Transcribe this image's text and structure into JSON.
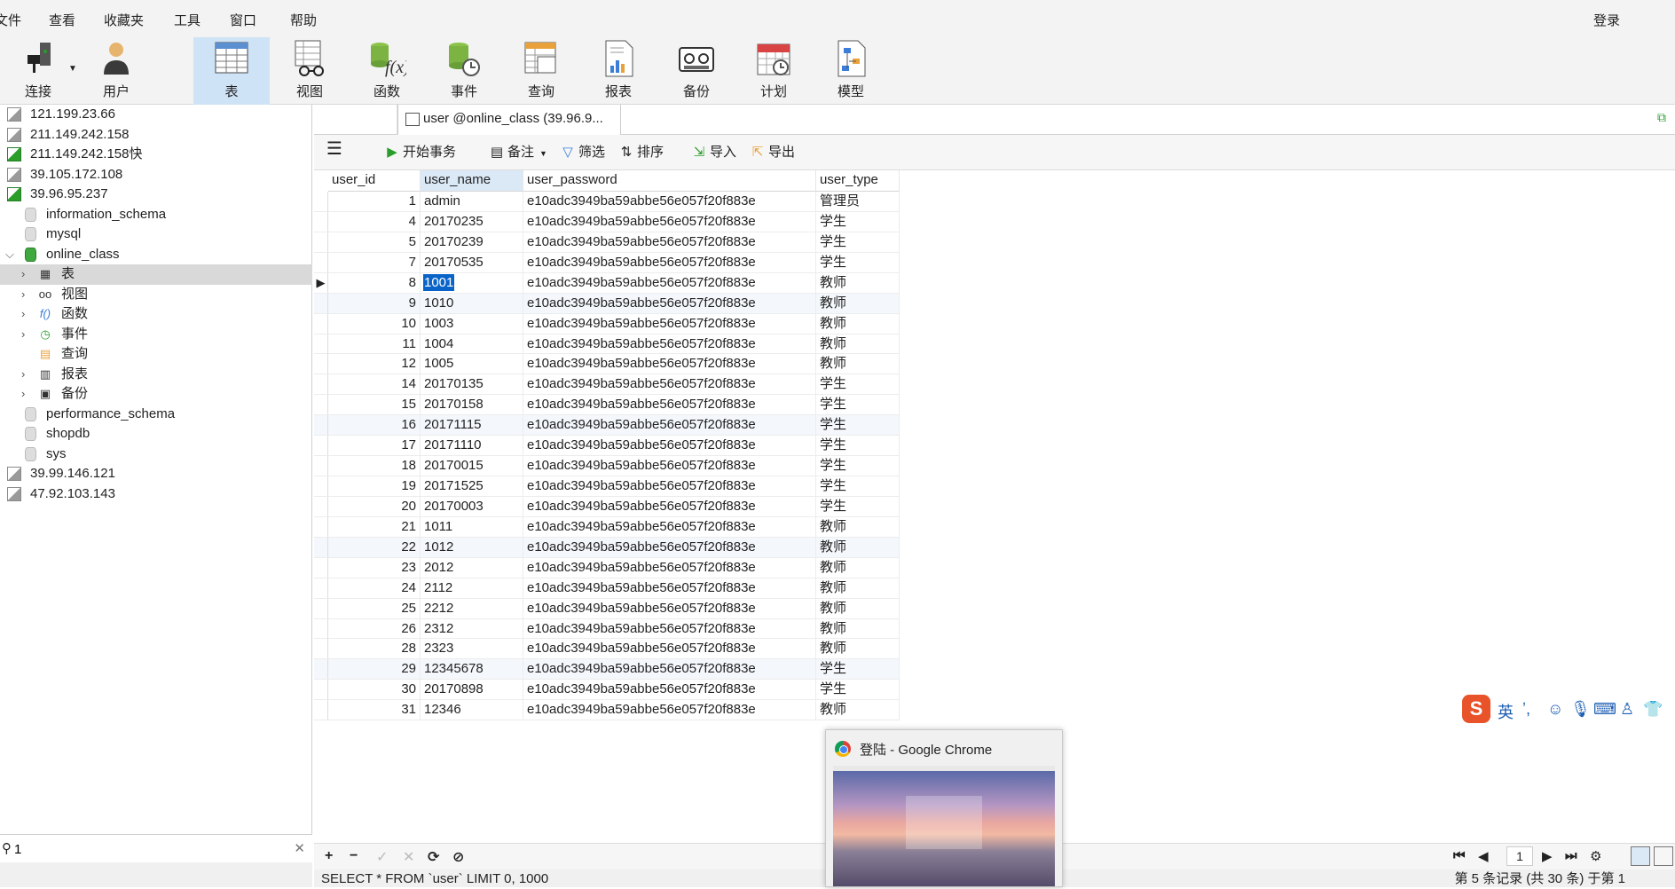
{
  "menu": {
    "items": [
      "文件",
      "查看",
      "收藏夹",
      "工具",
      "窗口",
      "帮助"
    ],
    "login": "登录"
  },
  "toolbar": {
    "buttons": [
      {
        "label": "连接",
        "icon": "connect-icon"
      },
      {
        "label": "用户",
        "icon": "user-icon"
      },
      {
        "label": "表",
        "icon": "table-icon",
        "active": true
      },
      {
        "label": "视图",
        "icon": "view-icon"
      },
      {
        "label": "函数",
        "icon": "function-icon"
      },
      {
        "label": "事件",
        "icon": "event-icon"
      },
      {
        "label": "查询",
        "icon": "query-icon"
      },
      {
        "label": "报表",
        "icon": "report-icon"
      },
      {
        "label": "备份",
        "icon": "backup-icon"
      },
      {
        "label": "计划",
        "icon": "schedule-icon"
      },
      {
        "label": "模型",
        "icon": "model-icon"
      }
    ]
  },
  "sidebar": {
    "items": [
      {
        "text": "121.199.23.66",
        "kind": "conn",
        "on": false
      },
      {
        "text": "211.149.242.158",
        "kind": "conn",
        "on": false
      },
      {
        "text": "211.149.242.158快",
        "kind": "conn",
        "on": true
      },
      {
        "text": "39.105.172.108",
        "kind": "conn",
        "on": false
      },
      {
        "text": "39.96.95.237",
        "kind": "conn",
        "on": true
      },
      {
        "text": "information_schema",
        "kind": "db",
        "on": false
      },
      {
        "text": "mysql",
        "kind": "db",
        "on": false
      },
      {
        "text": "online_class",
        "kind": "db",
        "on": true
      },
      {
        "text": "表",
        "kind": "obj",
        "icon": "table-icon"
      },
      {
        "text": "视图",
        "kind": "obj",
        "icon": "view-icon"
      },
      {
        "text": "函数",
        "kind": "obj",
        "icon": "function-icon"
      },
      {
        "text": "事件",
        "kind": "obj",
        "icon": "event-icon"
      },
      {
        "text": "查询",
        "kind": "obj",
        "icon": "query-icon"
      },
      {
        "text": "报表",
        "kind": "obj",
        "icon": "report-icon"
      },
      {
        "text": "备份",
        "kind": "obj",
        "icon": "backup-icon"
      },
      {
        "text": "performance_schema",
        "kind": "db",
        "on": false
      },
      {
        "text": "shopdb",
        "kind": "db",
        "on": false
      },
      {
        "text": "sys",
        "kind": "db",
        "on": false
      },
      {
        "text": "39.99.146.121",
        "kind": "conn",
        "on": false
      },
      {
        "text": "47.92.103.143",
        "kind": "conn",
        "on": false
      }
    ],
    "search_value": "1",
    "search_icon": "search-icon",
    "clear_icon": "close-icon"
  },
  "tab": {
    "title": "user @online_class (39.96.9..."
  },
  "actions": {
    "menu_icon": "hamburger-menu-icon",
    "begin_transaction": "开始事务",
    "comment": "备注",
    "filter": "筛选",
    "sort": "排序",
    "import": "导入",
    "export": "导出"
  },
  "grid": {
    "columns": [
      "user_id",
      "user_name",
      "user_password",
      "user_type"
    ],
    "rows": [
      [
        "1",
        "admin",
        "e10adc3949ba59abbe56e057f20f883e",
        "管理员"
      ],
      [
        "4",
        "20170235",
        "e10adc3949ba59abbe56e057f20f883e",
        "学生"
      ],
      [
        "5",
        "20170239",
        "e10adc3949ba59abbe56e057f20f883e",
        "学生"
      ],
      [
        "7",
        "20170535",
        "e10adc3949ba59abbe56e057f20f883e",
        "学生"
      ],
      [
        "8",
        "1001",
        "e10adc3949ba59abbe56e057f20f883e",
        "教师"
      ],
      [
        "9",
        "1010",
        "e10adc3949ba59abbe56e057f20f883e",
        "教师"
      ],
      [
        "10",
        "1003",
        "e10adc3949ba59abbe56e057f20f883e",
        "教师"
      ],
      [
        "11",
        "1004",
        "e10adc3949ba59abbe56e057f20f883e",
        "教师"
      ],
      [
        "12",
        "1005",
        "e10adc3949ba59abbe56e057f20f883e",
        "教师"
      ],
      [
        "14",
        "20170135",
        "e10adc3949ba59abbe56e057f20f883e",
        "学生"
      ],
      [
        "15",
        "20170158",
        "e10adc3949ba59abbe56e057f20f883e",
        "学生"
      ],
      [
        "16",
        "20171115",
        "e10adc3949ba59abbe56e057f20f883e",
        "学生"
      ],
      [
        "17",
        "20171110",
        "e10adc3949ba59abbe56e057f20f883e",
        "学生"
      ],
      [
        "18",
        "20170015",
        "e10adc3949ba59abbe56e057f20f883e",
        "学生"
      ],
      [
        "19",
        "20171525",
        "e10adc3949ba59abbe56e057f20f883e",
        "学生"
      ],
      [
        "20",
        "20170003",
        "e10adc3949ba59abbe56e057f20f883e",
        "学生"
      ],
      [
        "21",
        "1011",
        "e10adc3949ba59abbe56e057f20f883e",
        "教师"
      ],
      [
        "22",
        "1012",
        "e10adc3949ba59abbe56e057f20f883e",
        "教师"
      ],
      [
        "23",
        "2012",
        "e10adc3949ba59abbe56e057f20f883e",
        "教师"
      ],
      [
        "24",
        "2112",
        "e10adc3949ba59abbe56e057f20f883e",
        "教师"
      ],
      [
        "25",
        "2212",
        "e10adc3949ba59abbe56e057f20f883e",
        "教师"
      ],
      [
        "26",
        "2312",
        "e10adc3949ba59abbe56e057f20f883e",
        "教师"
      ],
      [
        "28",
        "2323",
        "e10adc3949ba59abbe56e057f20f883e",
        "教师"
      ],
      [
        "29",
        "12345678",
        "e10adc3949ba59abbe56e057f20f883e",
        "学生"
      ],
      [
        "30",
        "20170898",
        "e10adc3949ba59abbe56e057f20f883e",
        "学生"
      ],
      [
        "31",
        "12346",
        "e10adc3949ba59abbe56e057f20f883e",
        "教师"
      ]
    ],
    "selected_row_index": 4,
    "current_marker_icon": "row-pointer-icon"
  },
  "grid_controls": {
    "add": "+",
    "delete": "−",
    "apply": "✓",
    "cancel": "✕",
    "refresh": "⟳",
    "stop": "⊘"
  },
  "status": {
    "sql": "SELECT * FROM `user` LIMIT 0, 1000",
    "record_info": "第 5 条记录 (共 30 条) 于第 1",
    "page": "1"
  },
  "chrome_preview": {
    "title": "登陆 - Google Chrome",
    "icon": "chrome-icon"
  },
  "ime": {
    "brand": "S",
    "lang": "英"
  },
  "colors": {
    "accent": "#0a64c8",
    "active_toolbar": "#cfe3f7",
    "connected": "#2a9d2a"
  }
}
